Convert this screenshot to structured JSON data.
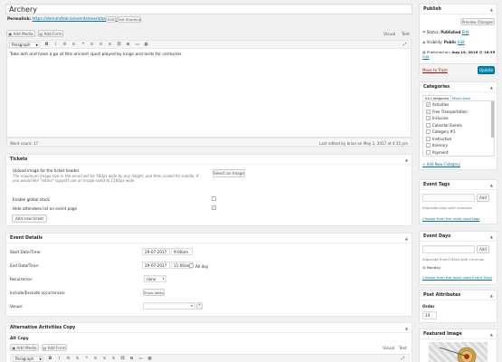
{
  "post": {
    "title": "Archery",
    "permalink_label": "Permalink:",
    "permalink_url": "https://demandtab.io/events/event/archery/",
    "edit_label": "Edit",
    "get_shortlink_label": "Get Shortlink",
    "add_media_label": "Add Media",
    "add_form_label": "Add Form",
    "tab_visual": "Visual",
    "tab_text": "Text",
    "format_select": "Paragraph",
    "content": "Take aim and have a go at this ancient sport played by kings and lords for centuries.",
    "word_count": "Word count: 17",
    "last_edited": "Last edited by brian on May 1, 2017 at 4:35 pm"
  },
  "tickets": {
    "title": "Tickets",
    "upload_title": "Upload image for the ticket header.",
    "upload_help": "The maximum image size in the email will be 580px wide by any height, and then scaled for mobile. If you would like \"retina\" support use an image sized to 1160px wide.",
    "select_image_label": "Select an Image",
    "global_stock_label": "Enable global stock",
    "hide_attendees_label": "Hide attendees list on event page",
    "add_ticket_label": "Add new ticket"
  },
  "event_details": {
    "title": "Event Details",
    "start_label": "Start Date/Time:",
    "start_date": "29-07-2017",
    "start_time": "9:00am",
    "end_label": "End Date/Time:",
    "end_date": "29-07-2017",
    "end_time": "11:00am",
    "all_day_label": "All day",
    "recurrence_label": "Recurrence:",
    "recurrence_value": "none",
    "include_exclude_label": "Include/Exclude occurrences:",
    "show_dates_label": "Show dates",
    "venue_label": "Venue:"
  },
  "alt_copy": {
    "title": "Alternative Activities Copy",
    "subtitle": "Alt Copy",
    "add_media_label": "Add Media",
    "add_form_label": "Add Form",
    "tab_visual": "Visual",
    "tab_text": "Text",
    "format_select": "Paragraph"
  },
  "publish": {
    "title": "Publish",
    "preview_label": "Preview Changes",
    "status_label": "Status:",
    "status_value": "Published",
    "visibility_label": "Visibility:",
    "visibility_value": "Public",
    "published_label": "Published on:",
    "published_value": "Aug 19, 2016 @ 18:35",
    "edit_label": "Edit",
    "trash_label": "Move to Trash",
    "update_label": "Update"
  },
  "categories": {
    "title": "Categories",
    "tab_all": "All Categories",
    "tab_most_used": "Most Used",
    "items": [
      {
        "label": "Activities",
        "checked": "✓"
      },
      {
        "label": "Free Transportation",
        "checked": "✓"
      },
      {
        "label": "Inclusive",
        "checked": "✓"
      },
      {
        "label": "Calendar Events",
        "checked": ""
      },
      {
        "label": "Category #1",
        "checked": ""
      },
      {
        "label": "Instructive",
        "checked": ""
      },
      {
        "label": "Itinerary",
        "checked": ""
      },
      {
        "label": "Payment",
        "checked": ""
      }
    ],
    "add_new_label": "+ Add New Category"
  },
  "event_tags": {
    "title": "Event Tags",
    "add_label": "Add",
    "help": "Separate tags with commas",
    "choose_label": "Choose from the most used tags"
  },
  "event_days": {
    "title": "Event Days",
    "add_label": "Add",
    "help": "Separate Event Days with commas",
    "tag_monday": "Monday",
    "choose_label": "Choose from the most used Event Days"
  },
  "post_attributes": {
    "title": "Post Attributes",
    "order_label": "Order",
    "order_value": "14"
  },
  "featured_image": {
    "title": "Featured Image"
  },
  "colors": {
    "accent": "#0073aa",
    "primary_button": "#0085ba",
    "trash": "#a00",
    "background": "#f1f1f1"
  }
}
